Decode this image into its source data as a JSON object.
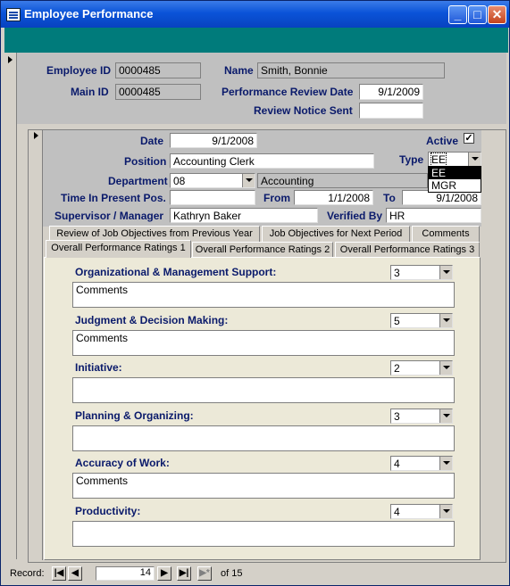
{
  "window": {
    "title": "Employee Performance",
    "minimize": "_",
    "maximize": "□",
    "close": "✕"
  },
  "header": {
    "employee_id_label": "Employee ID",
    "employee_id": "0000485",
    "name_label": "Name",
    "name": "Smith, Bonnie",
    "main_id_label": "Main ID",
    "main_id": "0000485",
    "review_date_label": "Performance Review Date",
    "review_date": "9/1/2009",
    "notice_sent_label": "Review Notice Sent",
    "notice_sent": ""
  },
  "subform": {
    "date_label": "Date",
    "date": "9/1/2008",
    "active_label": "Active",
    "active_check": "✓",
    "position_label": "Position",
    "position": "Accounting Clerk",
    "type_label": "Type",
    "type": "EE",
    "department_label": "Department",
    "department_code": "08",
    "department_name": "Accounting",
    "time_label": "Time In Present Pos.",
    "time": "",
    "from_label": "From",
    "from": "1/1/2008",
    "to_label": "To",
    "to": "9/1/2008",
    "supervisor_label": "Supervisor / Manager",
    "supervisor": "Kathryn Baker",
    "verified_label": "Verified By",
    "verified": "HR"
  },
  "type_dropdown": [
    "EE",
    "MGR"
  ],
  "tabs": {
    "row1": [
      "Review of Job Objectives from Previous Year",
      "Job Objectives for Next Period",
      "Comments"
    ],
    "row2": [
      "Overall Performance Ratings 1",
      "Overall Performance Ratings 2",
      "Overall Performance Ratings 3"
    ]
  },
  "ratings": [
    {
      "label": "Organizational & Management Support:",
      "value": "3",
      "comment": "Comments"
    },
    {
      "label": "Judgment & Decision Making:",
      "value": "5",
      "comment": "Comments"
    },
    {
      "label": "Initiative:",
      "value": "2",
      "comment": ""
    },
    {
      "label": "Planning & Organizing:",
      "value": "3",
      "comment": ""
    },
    {
      "label": "Accuracy of Work:",
      "value": "4",
      "comment": "Comments"
    },
    {
      "label": "Productivity:",
      "value": "4",
      "comment": ""
    }
  ],
  "nav": {
    "record_label": "Record:",
    "current": "14",
    "of_label": "of 15"
  },
  "colors": {
    "title_bar": "#0a53d8",
    "teal_band": "#007b7b",
    "label_text": "#0a1a6b"
  }
}
